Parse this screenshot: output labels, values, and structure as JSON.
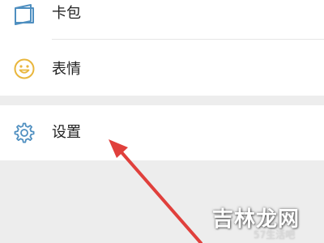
{
  "menu": {
    "items": [
      {
        "label": "卡包",
        "icon": "card-wallet-icon"
      },
      {
        "label": "表情",
        "icon": "smiley-icon"
      }
    ],
    "settings": {
      "label": "设置",
      "icon": "gear-icon"
    }
  },
  "colors": {
    "accent_icon_blue": "#4f8fc0",
    "smiley_yellow": "#e9b63c",
    "arrow_red": "#e0403c",
    "background": "#ededed",
    "row_background": "#ffffff"
  },
  "watermark": {
    "main": "吉林龙网",
    "sub": "57生活吧"
  }
}
